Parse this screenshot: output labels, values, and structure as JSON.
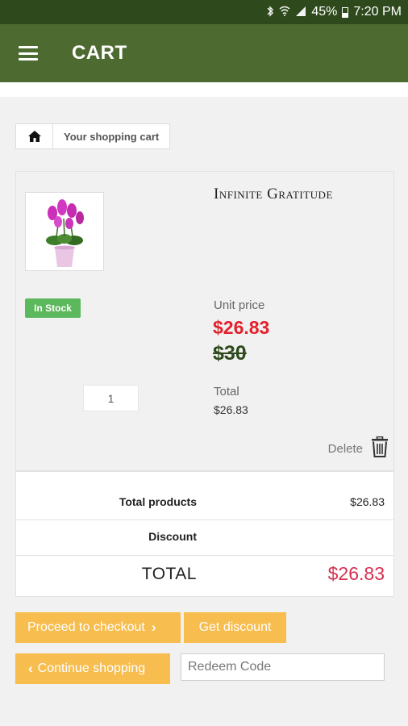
{
  "status_bar": {
    "battery": "45%",
    "time": "7:20 PM",
    "icons": [
      "bluetooth-icon",
      "wifi-icon",
      "signal-icon",
      "battery-icon"
    ]
  },
  "app_bar": {
    "title": "CART",
    "menu_icon": "hamburger-menu-icon"
  },
  "breadcrumb": {
    "home_icon": "home-icon",
    "label": "Your shopping cart"
  },
  "cart_item": {
    "name": "Infinite Gratitude",
    "stock_status": "In Stock",
    "quantity": "1",
    "unit_price_label": "Unit price",
    "price_new": "$26.83",
    "price_old": "$30",
    "total_label": "Total",
    "total_value": "$26.83",
    "delete_label": "Delete",
    "delete_icon": "trash-icon"
  },
  "totals": {
    "products_label": "Total products",
    "products_value": "$26.83",
    "discount_label": "Discount",
    "discount_value": "",
    "total_label": "TOTAL",
    "total_value": "$26.83"
  },
  "actions": {
    "checkout_label": "Proceed to checkout",
    "discount_label": "Get discount",
    "continue_label": "Continue shopping",
    "redeem_placeholder": "Redeem Code"
  },
  "colors": {
    "status_bar": "#2e4a1c",
    "app_bar": "#4d6a30",
    "button": "#f7bd4e",
    "price_new": "#e3202c",
    "price_old": "#2e4a1c",
    "grand_total": "#d6304f",
    "in_stock": "#5cb85c"
  }
}
